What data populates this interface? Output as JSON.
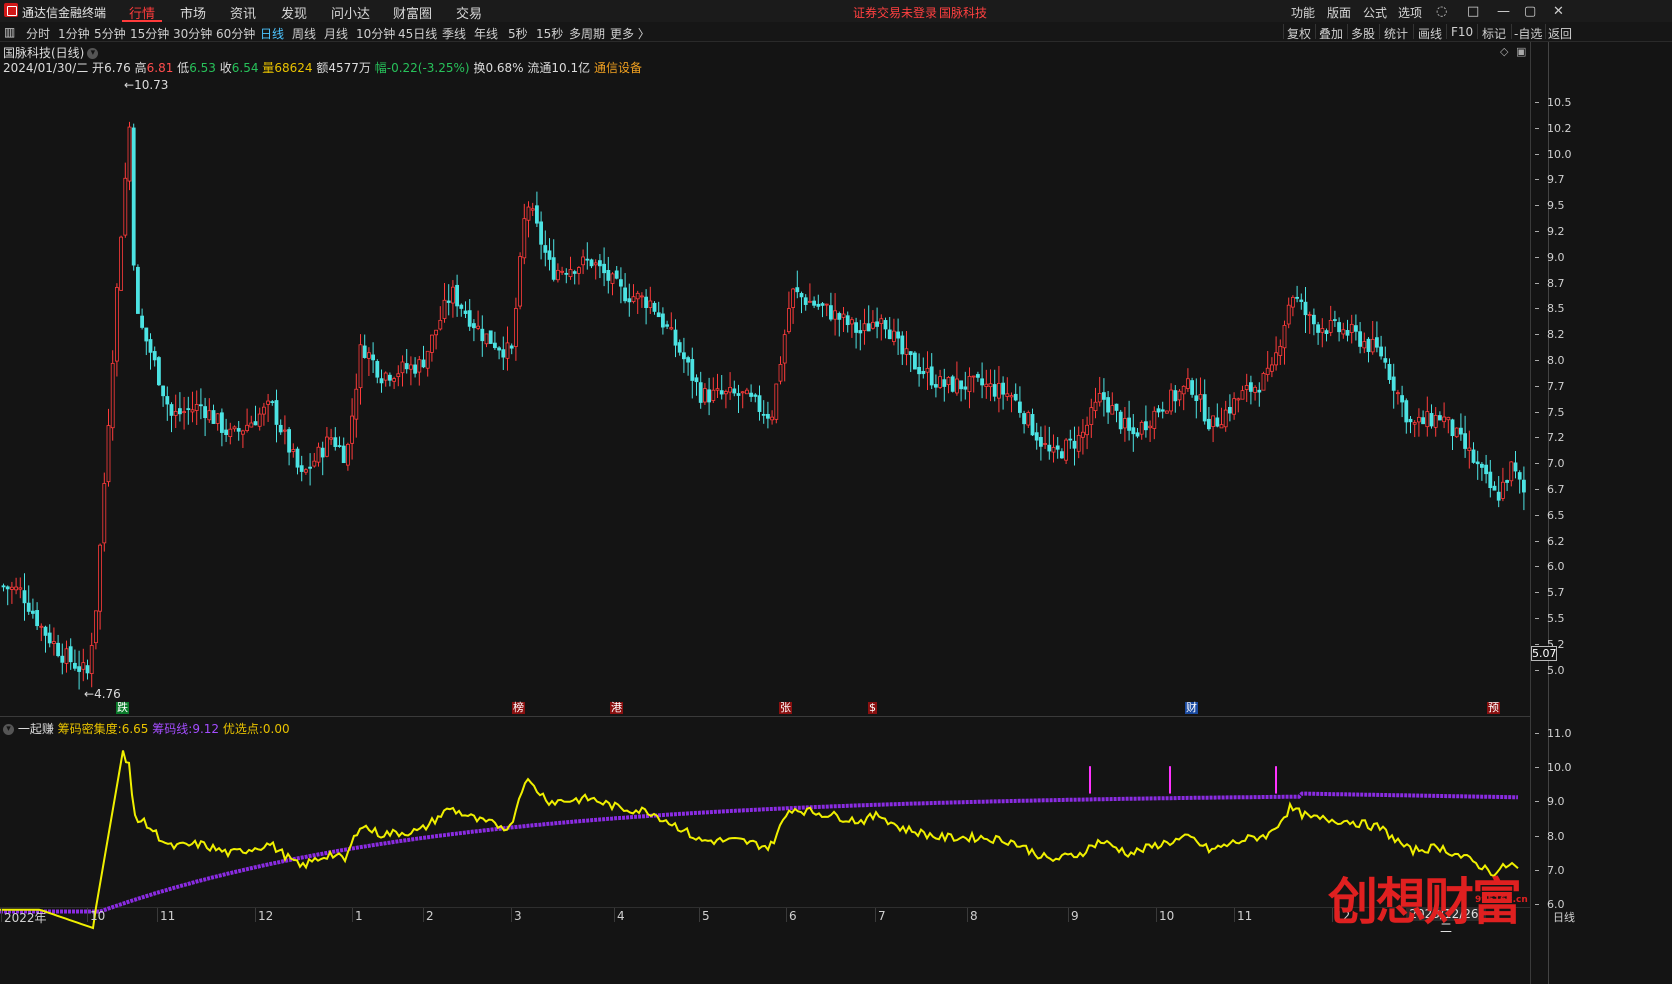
{
  "app": {
    "title": "通达信金融终端"
  },
  "top_menu": [
    "行情",
    "市场",
    "资讯",
    "发现",
    "问小达",
    "财富圈",
    "交易"
  ],
  "center_message": {
    "login": "证券交易未登录",
    "stock": "国脉科技"
  },
  "right_menu": [
    "功能",
    "版面",
    "公式",
    "选项"
  ],
  "periods": [
    "分时",
    "1分钟",
    "5分钟",
    "15分钟",
    "30分钟",
    "60分钟",
    "日线",
    "周线",
    "月线",
    "10分钟",
    "45日线",
    "季线",
    "年线",
    "5秒",
    "15秒",
    "多周期",
    "更多 〉"
  ],
  "toolbar_right": [
    "复权",
    "叠加",
    "多股",
    "统计",
    "画线",
    "F10",
    "标记",
    "-自选",
    "返回"
  ],
  "stock_header": {
    "title": "国脉科技(日线)",
    "date": "2024/01/30/二",
    "open_label": "开",
    "open": "6.76",
    "high_label": "高",
    "high": "6.81",
    "low_label": "低",
    "low": "6.53",
    "close_label": "收",
    "close": "6.54",
    "volume_label": "量",
    "volume": "68624",
    "amount_label": "额",
    "amount": "4577万",
    "change_label": "幅",
    "change": "-0.22(-3.25%)",
    "turnover_label": "换",
    "turnover": "0.68%",
    "float_label": "流通",
    "float": "10.1亿",
    "sector": "通信设备"
  },
  "price_axis": [
    "10.5",
    "10.2",
    "10.0",
    "9.7",
    "9.5",
    "9.2",
    "9.0",
    "8.7",
    "8.5",
    "8.2",
    "8.0",
    "7.7",
    "7.5",
    "7.2",
    "7.0",
    "6.7",
    "6.5",
    "6.2",
    "6.0",
    "5.7",
    "5.5",
    "5.2",
    "5.0"
  ],
  "current_price_box": "5.07",
  "high_marker": "10.73",
  "low_marker": "4.76",
  "events": [
    {
      "label": "跌",
      "type": "up"
    },
    {
      "label": "榜",
      "type": "dn"
    },
    {
      "label": "港",
      "type": "dn"
    },
    {
      "label": "张",
      "type": "dn"
    },
    {
      "label": "$",
      "type": "dn"
    },
    {
      "label": "财",
      "type": "up"
    },
    {
      "label": "预",
      "type": "dn"
    }
  ],
  "indicator": {
    "name": "一起赚",
    "l1_label": "筹码密集度:",
    "l1_value": "6.65",
    "l2_label": "筹码线:",
    "l2_value": "9.12",
    "l3_label": "优选点:",
    "l3_value": "0.00",
    "axis": [
      "11.0",
      "10.0",
      "9.0",
      "8.0",
      "7.0",
      "6.0"
    ]
  },
  "x_axis": [
    "2022年",
    "10",
    "11",
    "12",
    "1",
    "2",
    "3",
    "4",
    "5",
    "6",
    "7",
    "8",
    "9",
    "10",
    "11",
    "12"
  ],
  "x_date_box": "2023/12/26/二",
  "x_unit": "日线",
  "watermark": {
    "text": "创想财富",
    "url": "995168.cn"
  },
  "colors": {
    "up": "#ff3b3b",
    "down": "#4ce3e3",
    "line1": "#f0f000",
    "line2": "#8a2be2",
    "marker": "#ff33ff"
  }
}
